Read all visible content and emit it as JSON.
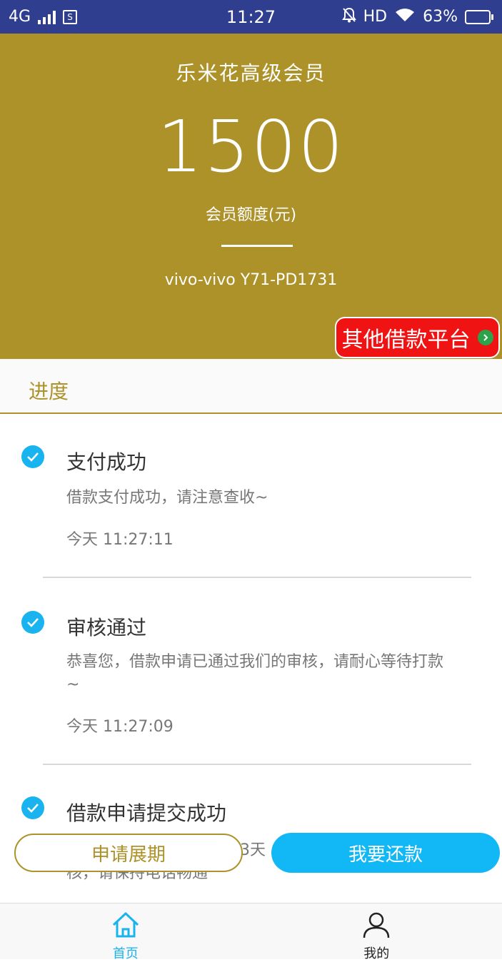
{
  "status_bar": {
    "network": "4G",
    "time": "11:27",
    "hd": "HD",
    "battery": "63%",
    "battery_level": 0.63
  },
  "hero": {
    "title": "乐米花高级会员",
    "amount": "1500",
    "amount_label": "会员额度(元)",
    "device": "vivo-vivo Y71-PD1731",
    "other_platform_label": "其他借款平台"
  },
  "progress": {
    "title": "进度",
    "steps": [
      {
        "title": "支付成功",
        "desc": "借款支付成功，请注意查收~",
        "time": "今天 11:27:11"
      },
      {
        "title": "审核通过",
        "desc": "恭喜您，借款申请已通过我们的审核，请耐心等待打款",
        "desc2": "~",
        "time": "今天 11:27:09"
      },
      {
        "title": "借款申请提交成功",
        "desc_partial": "3天",
        "desc2": "核，请保持电话畅通"
      }
    ]
  },
  "actions": {
    "extend_label": "申请展期",
    "repay_label": "我要还款"
  },
  "bottom_nav": {
    "home_label": "首页",
    "mine_label": "我的"
  },
  "colors": {
    "gold": "#ad9229",
    "accent_blue": "#19b3ef",
    "status_bar": "#2f3e8f",
    "promo_red": "#f01313"
  }
}
